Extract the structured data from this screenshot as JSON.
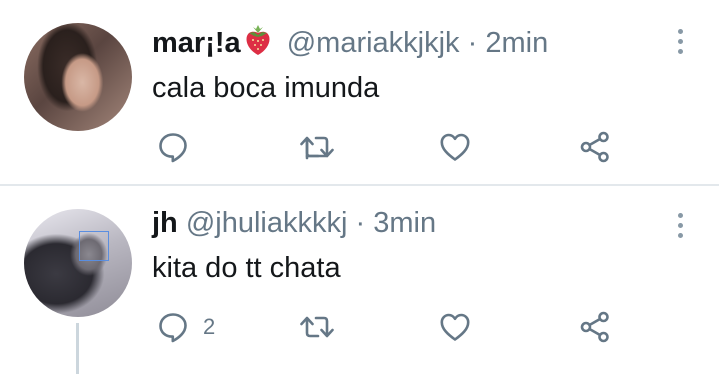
{
  "tweets": [
    {
      "display_name": "mar¡!a",
      "emoji": "strawberry-emoji",
      "handle": "@mariakkjkjk",
      "separator": "·",
      "time": "2min",
      "text": "cala boca imunda",
      "reply_count": "",
      "avatar": "profile-photo"
    },
    {
      "display_name": "jh",
      "handle": "@jhuliakkkkj",
      "separator": "·",
      "time": "3min",
      "text": "kita do tt chata",
      "reply_count": "2",
      "avatar": "profile-photo"
    }
  ],
  "icons": {
    "reply": "reply-icon",
    "retweet": "retweet-icon",
    "like": "heart-icon",
    "share": "share-icon",
    "more": "more-options-icon"
  },
  "colors": {
    "icon": "#657786",
    "text": "#14171a",
    "secondary": "#657786",
    "divider": "#e3e8ec",
    "thread_line": "#ccd6dd"
  }
}
